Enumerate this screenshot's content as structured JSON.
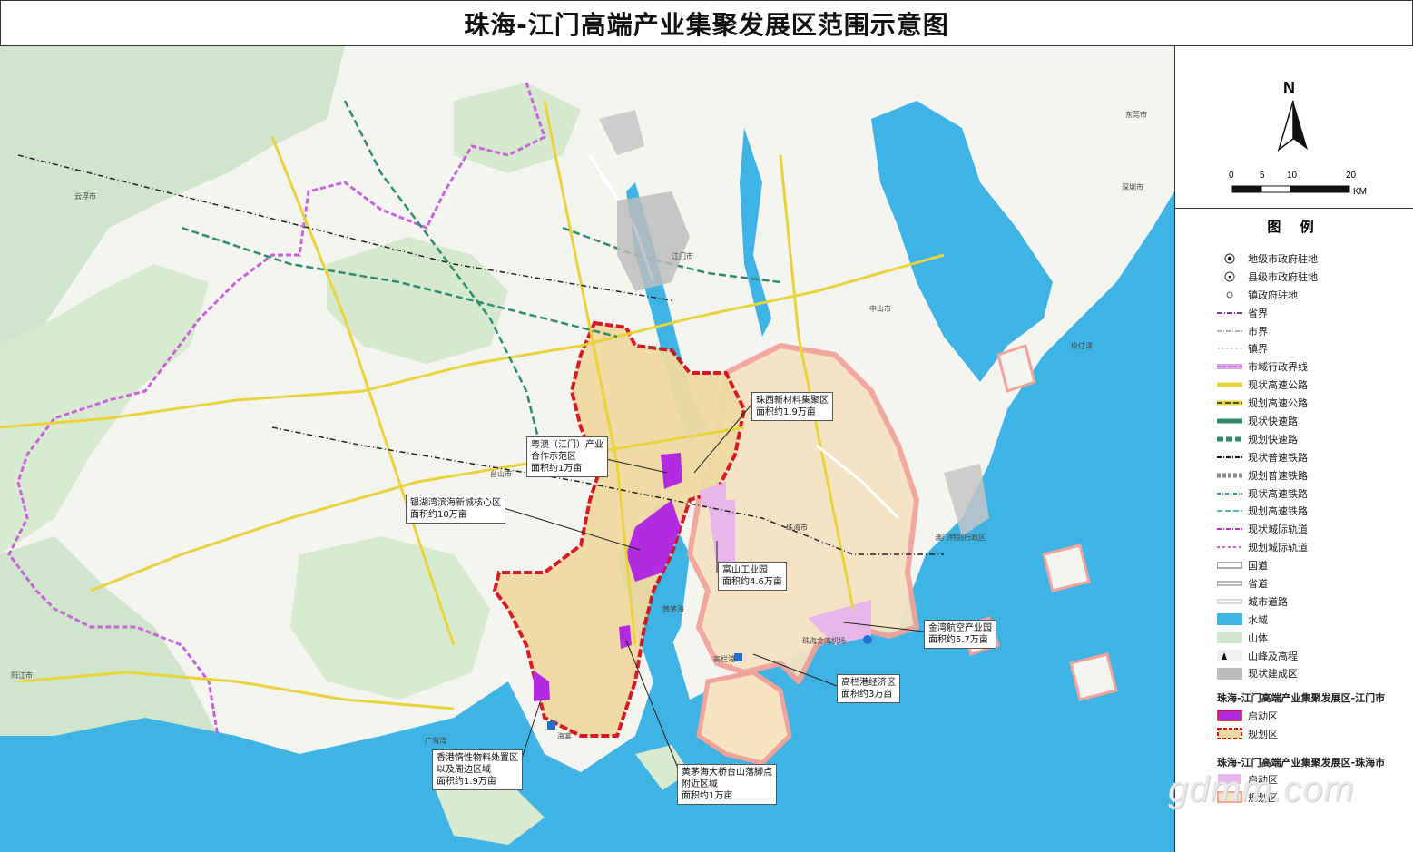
{
  "title": "珠海-江门高端产业集聚发展区范围示意图",
  "compass": {
    "north": "N",
    "scale_ticks": [
      "0",
      "5",
      "10",
      "20"
    ],
    "scale_unit": "KM"
  },
  "legend": {
    "title": "图  例",
    "items": [
      {
        "label": "地级市政府驻地",
        "icon": "city-seat-icon"
      },
      {
        "label": "县级市政府驻地",
        "icon": "county-seat-icon"
      },
      {
        "label": "镇政府驻地",
        "icon": "town-seat-icon"
      },
      {
        "label": "省界",
        "icon": "province-boundary-icon"
      },
      {
        "label": "市界",
        "icon": "city-boundary-icon"
      },
      {
        "label": "镇界",
        "icon": "town-boundary-icon"
      },
      {
        "label": "市域行政界线",
        "icon": "municipal-boundary-icon"
      },
      {
        "label": "现状高速公路",
        "icon": "existing-expressway-icon"
      },
      {
        "label": "规划高速公路",
        "icon": "planned-expressway-icon"
      },
      {
        "label": "现状快速路",
        "icon": "existing-express-road-icon"
      },
      {
        "label": "规划快速路",
        "icon": "planned-express-road-icon"
      },
      {
        "label": "现状普速铁路",
        "icon": "existing-railway-icon"
      },
      {
        "label": "规划普速铁路",
        "icon": "planned-railway-icon"
      },
      {
        "label": "现状高速铁路",
        "icon": "existing-hsr-icon"
      },
      {
        "label": "规划高速铁路",
        "icon": "planned-hsr-icon"
      },
      {
        "label": "现状城际轨道",
        "icon": "existing-intercity-icon"
      },
      {
        "label": "规划城际轨道",
        "icon": "planned-intercity-icon"
      },
      {
        "label": "国道",
        "icon": "national-road-icon"
      },
      {
        "label": "省道",
        "icon": "provincial-road-icon"
      },
      {
        "label": "城市道路",
        "icon": "city-road-icon"
      },
      {
        "label": "水域",
        "icon": "water-icon"
      },
      {
        "label": "山体",
        "icon": "mountain-icon"
      },
      {
        "label": "山峰及高程",
        "icon": "peak-icon"
      },
      {
        "label": "现状建成区",
        "icon": "built-up-icon"
      }
    ],
    "jiangmen_head": "珠海-江门高端产业集聚发展区-江门市",
    "jiangmen_items": [
      {
        "label": "启动区",
        "icon": "jm-start-zone-icon"
      },
      {
        "label": "规划区",
        "icon": "jm-plan-zone-icon"
      }
    ],
    "zhuhai_head": "珠海-江门高端产业集聚发展区-珠海市",
    "zhuhai_items": [
      {
        "label": "启动区",
        "icon": "zh-start-zone-icon"
      },
      {
        "label": "规划区",
        "icon": "zh-plan-zone-icon"
      }
    ]
  },
  "callouts": [
    {
      "id": "zhuxi",
      "lines": [
        "珠西新材料集聚区",
        "面积约1.9万亩"
      ]
    },
    {
      "id": "yueao",
      "lines": [
        "粤澳（江门）产业",
        "合作示范区",
        "面积约1万亩"
      ]
    },
    {
      "id": "yinhu",
      "lines": [
        "银湖湾滨海新城核心区",
        "面积约10万亩"
      ]
    },
    {
      "id": "fushan",
      "lines": [
        "富山工业园",
        "面积约4.6万亩"
      ]
    },
    {
      "id": "jinwan",
      "lines": [
        "金湾航空产业园",
        "面积约5.7万亩"
      ]
    },
    {
      "id": "gaolan",
      "lines": [
        "高栏港经济区",
        "面积约3万亩"
      ]
    },
    {
      "id": "xianggang",
      "lines": [
        "香港惰性物料处置区",
        "以及周边区域",
        "面积约1.9万亩"
      ]
    },
    {
      "id": "huangmao",
      "lines": [
        "黄茅海大桥台山落脚点",
        "附近区域",
        "面积约1万亩"
      ]
    }
  ],
  "places": {
    "jiangmen": "江门市",
    "zhongshan": "中山市",
    "zhuhai": "珠海市",
    "gaolangang": "高栏港",
    "airport": "珠海金湾机场",
    "guanghai": "广海湾",
    "huangmaohai": "黄茅海",
    "haiyan": "海宴",
    "dongguan": "东莞市",
    "shenzhen": "深圳市",
    "taishan": "台山市",
    "lingding": "伶仃洋",
    "yangjiang": "阳江市",
    "yunfu": "云浮市",
    "macau": "澳门特别行政区"
  },
  "watermark": "gdmm.com",
  "colors": {
    "water": "#3fb3e3",
    "mountain": "#cfe5cc",
    "plan_zone_fill": "#f0d9a2",
    "plan_boundary": "#d4101a",
    "start_zone": "#b12be0",
    "zh_plan_boundary": "#f0a39a",
    "zh_start_zone": "#e6b6ea",
    "municipal_boundary": "#c763d9",
    "expressway": "#e8d33c",
    "express_road": "#2f8b6e"
  }
}
